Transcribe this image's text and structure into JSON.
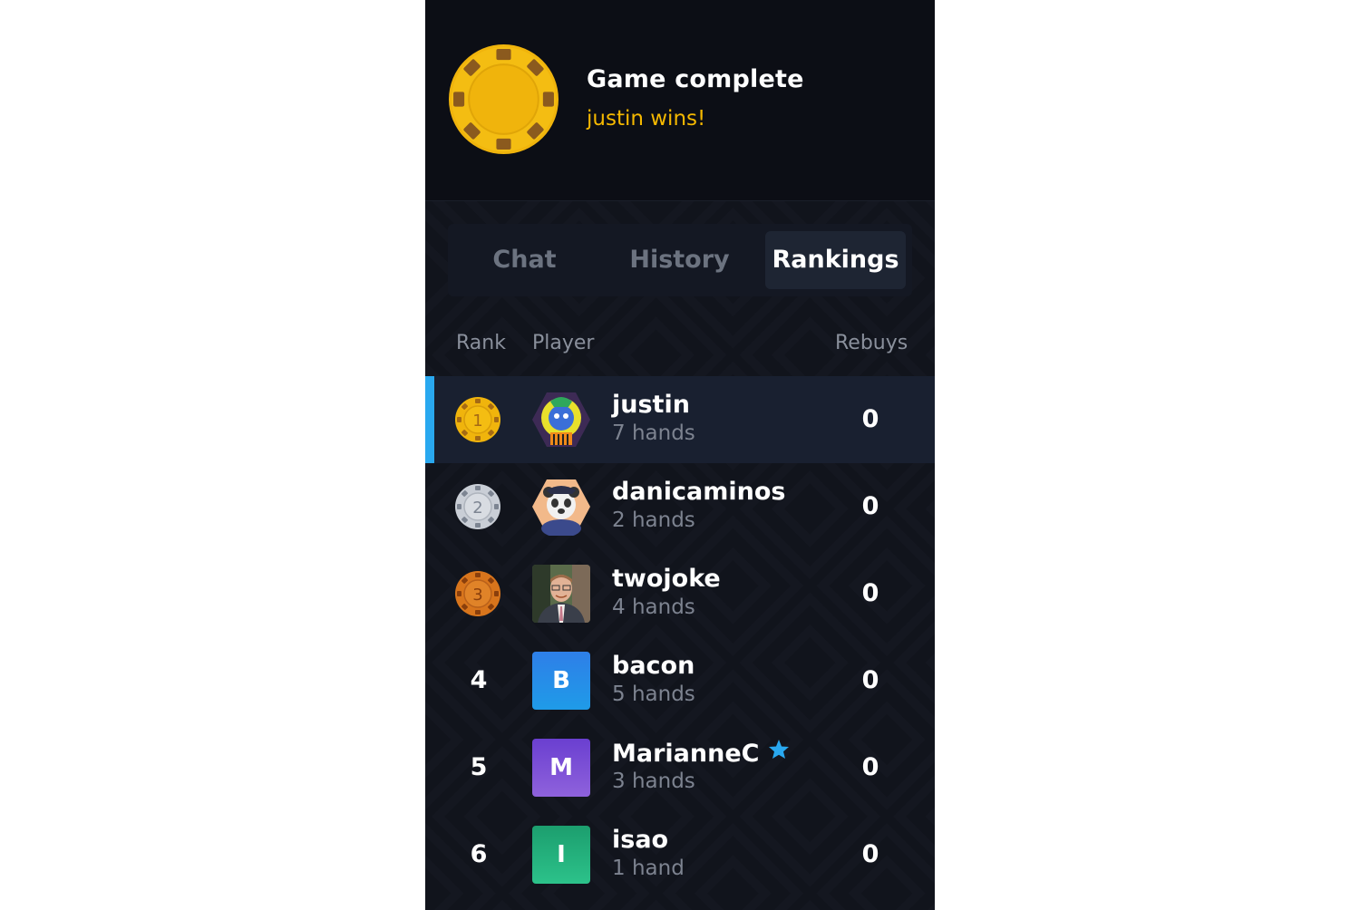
{
  "header": {
    "title": "Game complete",
    "subtitle": "justin wins!",
    "chip_color": "#f0b40c"
  },
  "tabs": [
    {
      "label": "Chat",
      "active": false
    },
    {
      "label": "History",
      "active": false
    },
    {
      "label": "Rankings",
      "active": true
    }
  ],
  "table": {
    "headers": {
      "rank": "Rank",
      "player": "Player",
      "rebuys": "Rebuys"
    },
    "rows": [
      {
        "rank": "1",
        "badge": "gold",
        "name": "justin",
        "hands": "7 hands",
        "rebuys": "0",
        "avatar": "cartoon-wolf-avatar",
        "highlight": true
      },
      {
        "rank": "2",
        "badge": "silver",
        "name": "danicaminos",
        "hands": "2 hands",
        "rebuys": "0",
        "avatar": "cartoon-panda-avatar"
      },
      {
        "rank": "3",
        "badge": "bronze",
        "name": "twojoke",
        "hands": "4 hands",
        "rebuys": "0",
        "avatar": "photo-avatar"
      },
      {
        "rank": "4",
        "name": "bacon",
        "hands": "5 hands",
        "rebuys": "0",
        "avatar_letter": "B",
        "avatar_color": "#2a86e6"
      },
      {
        "rank": "5",
        "name": "MarianneC",
        "hands": "3 hands",
        "rebuys": "0",
        "avatar_letter": "M",
        "avatar_color": "#7b4fd6",
        "starred": true
      },
      {
        "rank": "6",
        "name": "isao",
        "hands": "1 hand",
        "rebuys": "0",
        "avatar_letter": "I",
        "avatar_color": "#1eaf7c"
      }
    ]
  },
  "colors": {
    "accent": "#29a8ef",
    "winner_text": "#f5b800",
    "gold": "#f0b40c",
    "silver": "#c9ced6",
    "bronze": "#d8751c"
  }
}
